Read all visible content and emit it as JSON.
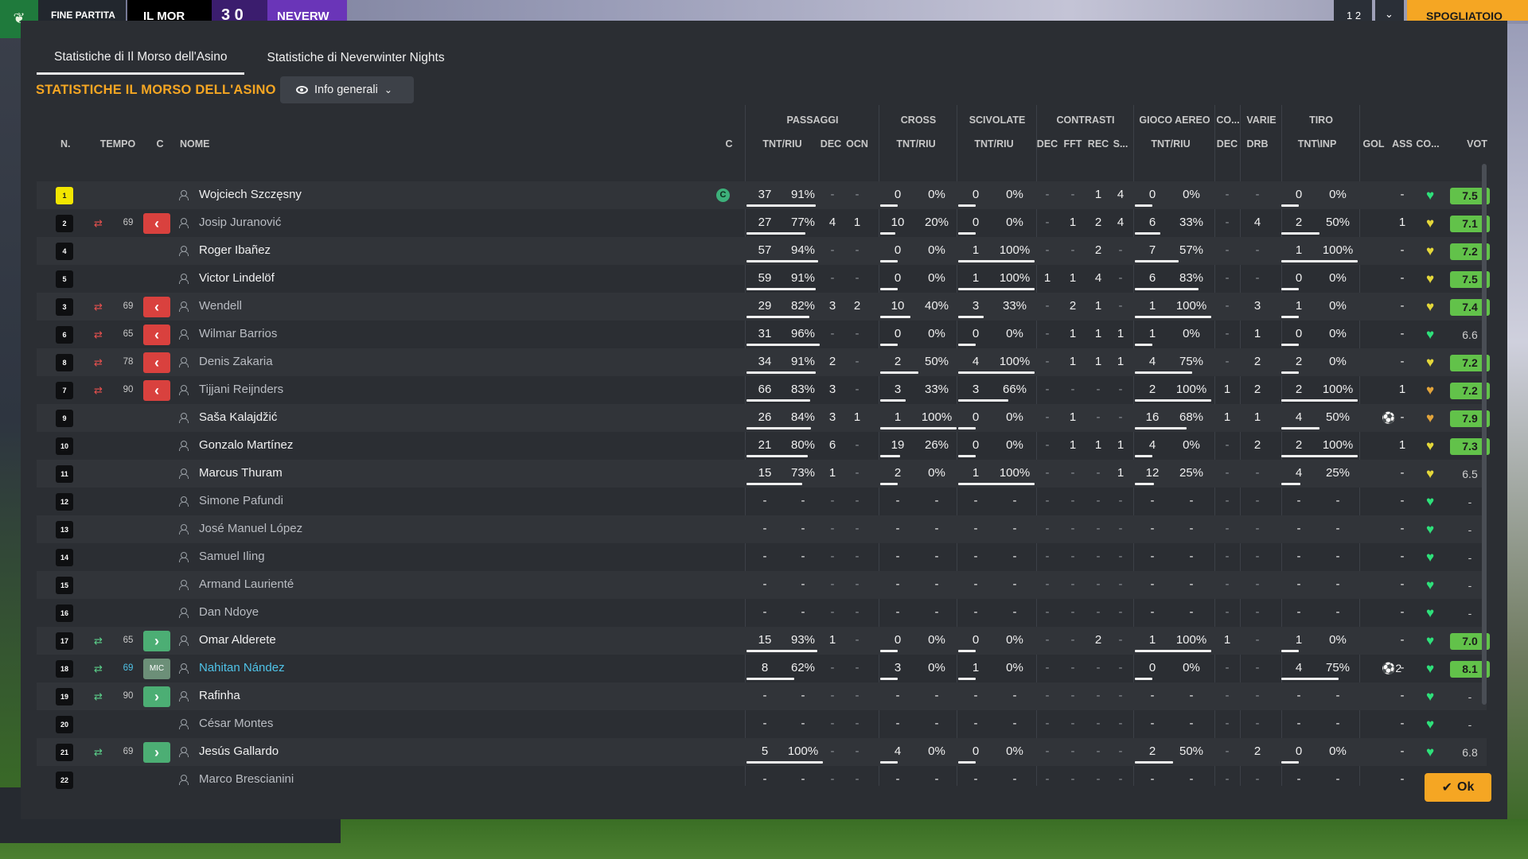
{
  "topbar": {
    "end_label": "FINE PARTITA",
    "home_team": "IL MOR",
    "score": "3 0",
    "away_team": "NEVERW",
    "right_label_1": "1 2",
    "right_label_2": "⌄",
    "right_label_3": "SPOGLIATOIO"
  },
  "tabs": [
    {
      "label": "Statistiche di Il Morso dell'Asino",
      "active": true
    },
    {
      "label": "Statistiche di Neverwinter Nights",
      "active": false
    }
  ],
  "section_title": "STATISTICHE IL MORSO DELL'ASINO",
  "view_dropdown": {
    "label": "Info generali"
  },
  "groups": [
    "PASSAGGI",
    "CROSS",
    "SCIVOLATE",
    "CONTRASTI",
    "GIOCO AEREO",
    "CO...",
    "VARIE",
    "TIRO"
  ],
  "headers": {
    "num": "N.",
    "tempo": "TEMPO",
    "c": "C",
    "nome": "NOME",
    "capt": "C",
    "pass_tr": "TNT/RIU",
    "pass_dec": "DEC",
    "pass_ocn": "OCN",
    "cross_tr": "TNT/RIU",
    "tack_tr": "TNT/RIU",
    "con_dec": "DEC",
    "con_fft": "FFT",
    "con_rec": "REC",
    "con_s": "S...",
    "air_tr": "TNT/RIU",
    "co_dec": "DEC",
    "var_drb": "DRB",
    "shot_tr": "TNT\\INP",
    "gol": "GOL",
    "ass": "ASS",
    "co": "CO...",
    "vot": "VOT"
  },
  "players": [
    {
      "num": "1",
      "gk": true,
      "name": "Wojciech Szczęsny",
      "captain": "C",
      "sub": null,
      "min": "",
      "pt": "37",
      "pr": "91%",
      "pdec": "-",
      "pocn": "-",
      "ct": "0",
      "cr": "0%",
      "tt": "0",
      "tr": "0%",
      "cdec": "-",
      "cfft": "-",
      "crec": "1",
      "cs": "4",
      "at": "0",
      "ar": "0%",
      "codec": "-",
      "drb": "-",
      "st": "0",
      "sr": "0%",
      "gol": "",
      "ass": "-",
      "heart": "green",
      "vot": "7.5",
      "vot_style": "good",
      "pass_pct": 91,
      "cross_pct": 0,
      "tack_pct": 0,
      "air_pct": 0,
      "shot_pct": 0,
      "style": ""
    },
    {
      "num": "2",
      "gk": false,
      "name": "Josip Juranović",
      "captain": "",
      "sub": "out",
      "min": "69",
      "pt": "27",
      "pr": "77%",
      "pdec": "4",
      "pocn": "1",
      "ct": "10",
      "cr": "20%",
      "tt": "0",
      "tr": "0%",
      "cdec": "-",
      "cfft": "1",
      "crec": "2",
      "cs": "4",
      "at": "6",
      "ar": "33%",
      "codec": "-",
      "drb": "4",
      "st": "2",
      "sr": "50%",
      "gol": "",
      "ass": "1",
      "heart": "yellow",
      "vot": "7.1",
      "vot_style": "good",
      "pass_pct": 77,
      "cross_pct": 20,
      "tack_pct": 0,
      "air_pct": 33,
      "shot_pct": 50,
      "style": "inactive"
    },
    {
      "num": "4",
      "gk": false,
      "name": "Roger Ibañez",
      "captain": "",
      "sub": null,
      "min": "",
      "pt": "57",
      "pr": "94%",
      "pdec": "-",
      "pocn": "-",
      "ct": "0",
      "cr": "0%",
      "tt": "1",
      "tr": "100%",
      "cdec": "-",
      "cfft": "-",
      "crec": "2",
      "cs": "-",
      "at": "7",
      "ar": "57%",
      "codec": "-",
      "drb": "-",
      "st": "1",
      "sr": "100%",
      "gol": "",
      "ass": "-",
      "heart": "yellow",
      "vot": "7.2",
      "vot_style": "good",
      "pass_pct": 94,
      "cross_pct": 0,
      "tack_pct": 100,
      "air_pct": 57,
      "shot_pct": 100,
      "style": ""
    },
    {
      "num": "5",
      "gk": false,
      "name": "Victor Lindelöf",
      "captain": "",
      "sub": null,
      "min": "",
      "pt": "59",
      "pr": "91%",
      "pdec": "-",
      "pocn": "-",
      "ct": "0",
      "cr": "0%",
      "tt": "1",
      "tr": "100%",
      "cdec": "1",
      "cfft": "1",
      "crec": "4",
      "cs": "-",
      "at": "6",
      "ar": "83%",
      "codec": "-",
      "drb": "-",
      "st": "0",
      "sr": "0%",
      "gol": "",
      "ass": "-",
      "heart": "yellow",
      "vot": "7.5",
      "vot_style": "good",
      "pass_pct": 91,
      "cross_pct": 0,
      "tack_pct": 100,
      "air_pct": 83,
      "shot_pct": 0,
      "style": ""
    },
    {
      "num": "3",
      "gk": false,
      "name": "Wendell",
      "captain": "",
      "sub": "out",
      "min": "69",
      "pt": "29",
      "pr": "82%",
      "pdec": "3",
      "pocn": "2",
      "ct": "10",
      "cr": "40%",
      "tt": "3",
      "tr": "33%",
      "cdec": "-",
      "cfft": "2",
      "crec": "1",
      "cs": "-",
      "at": "1",
      "ar": "100%",
      "codec": "-",
      "drb": "3",
      "st": "1",
      "sr": "0%",
      "gol": "",
      "ass": "-",
      "heart": "yellow",
      "vot": "7.4",
      "vot_style": "good",
      "pass_pct": 82,
      "cross_pct": 40,
      "tack_pct": 33,
      "air_pct": 100,
      "shot_pct": 0,
      "style": "inactive"
    },
    {
      "num": "6",
      "gk": false,
      "name": "Wilmar Barrios",
      "captain": "",
      "sub": "out",
      "min": "65",
      "pt": "31",
      "pr": "96%",
      "pdec": "-",
      "pocn": "-",
      "ct": "0",
      "cr": "0%",
      "tt": "0",
      "tr": "0%",
      "cdec": "-",
      "cfft": "1",
      "crec": "1",
      "cs": "1",
      "at": "1",
      "ar": "0%",
      "codec": "-",
      "drb": "1",
      "st": "0",
      "sr": "0%",
      "gol": "",
      "ass": "-",
      "heart": "green",
      "vot": "6.6",
      "vot_style": "plain",
      "pass_pct": 96,
      "cross_pct": 0,
      "tack_pct": 0,
      "air_pct": 0,
      "shot_pct": 0,
      "style": "inactive"
    },
    {
      "num": "8",
      "gk": false,
      "name": "Denis Zakaria",
      "captain": "",
      "sub": "out",
      "min": "78",
      "pt": "34",
      "pr": "91%",
      "pdec": "2",
      "pocn": "-",
      "ct": "2",
      "cr": "50%",
      "tt": "4",
      "tr": "100%",
      "cdec": "-",
      "cfft": "1",
      "crec": "1",
      "cs": "1",
      "at": "4",
      "ar": "75%",
      "codec": "-",
      "drb": "2",
      "st": "2",
      "sr": "0%",
      "gol": "",
      "ass": "-",
      "heart": "yellow",
      "vot": "7.2",
      "vot_style": "good",
      "pass_pct": 91,
      "cross_pct": 50,
      "tack_pct": 100,
      "air_pct": 75,
      "shot_pct": 0,
      "style": "inactive"
    },
    {
      "num": "7",
      "gk": false,
      "name": "Tijjani Reijnders",
      "captain": "",
      "sub": "out",
      "min": "90",
      "pt": "66",
      "pr": "83%",
      "pdec": "3",
      "pocn": "-",
      "ct": "3",
      "cr": "33%",
      "tt": "3",
      "tr": "66%",
      "cdec": "-",
      "cfft": "-",
      "crec": "-",
      "cs": "-",
      "at": "2",
      "ar": "100%",
      "codec": "1",
      "drb": "2",
      "st": "2",
      "sr": "100%",
      "gol": "",
      "ass": "1",
      "heart": "orange",
      "vot": "7.2",
      "vot_style": "good",
      "pass_pct": 83,
      "cross_pct": 33,
      "tack_pct": 66,
      "air_pct": 100,
      "shot_pct": 100,
      "style": "inactive"
    },
    {
      "num": "9",
      "gk": false,
      "name": "Saša Kalajdžić",
      "captain": "",
      "sub": null,
      "min": "",
      "pt": "26",
      "pr": "84%",
      "pdec": "3",
      "pocn": "1",
      "ct": "1",
      "cr": "100%",
      "tt": "0",
      "tr": "0%",
      "cdec": "-",
      "cfft": "1",
      "crec": "-",
      "cs": "-",
      "at": "16",
      "ar": "68%",
      "codec": "1",
      "drb": "1",
      "st": "4",
      "sr": "50%",
      "gol": "⚽",
      "ass": "-",
      "heart": "orange",
      "vot": "7.9",
      "vot_style": "good",
      "pass_pct": 84,
      "cross_pct": 100,
      "tack_pct": 0,
      "air_pct": 68,
      "shot_pct": 50,
      "style": ""
    },
    {
      "num": "10",
      "gk": false,
      "name": "Gonzalo Martínez",
      "captain": "",
      "sub": null,
      "min": "",
      "pt": "21",
      "pr": "80%",
      "pdec": "6",
      "pocn": "-",
      "ct": "19",
      "cr": "26%",
      "tt": "0",
      "tr": "0%",
      "cdec": "-",
      "cfft": "1",
      "crec": "1",
      "cs": "1",
      "at": "4",
      "ar": "0%",
      "codec": "-",
      "drb": "2",
      "st": "2",
      "sr": "100%",
      "gol": "",
      "ass": "1",
      "heart": "yellow",
      "vot": "7.3",
      "vot_style": "good",
      "pass_pct": 80,
      "cross_pct": 26,
      "tack_pct": 0,
      "air_pct": 0,
      "shot_pct": 100,
      "style": ""
    },
    {
      "num": "11",
      "gk": false,
      "name": "Marcus Thuram",
      "captain": "",
      "sub": null,
      "min": "",
      "pt": "15",
      "pr": "73%",
      "pdec": "1",
      "pocn": "-",
      "ct": "2",
      "cr": "0%",
      "tt": "1",
      "tr": "100%",
      "cdec": "-",
      "cfft": "-",
      "crec": "-",
      "cs": "1",
      "at": "12",
      "ar": "25%",
      "codec": "-",
      "drb": "-",
      "st": "4",
      "sr": "25%",
      "gol": "",
      "ass": "-",
      "heart": "yellow",
      "vot": "6.5",
      "vot_style": "plain",
      "pass_pct": 73,
      "cross_pct": 0,
      "tack_pct": 100,
      "air_pct": 25,
      "shot_pct": 25,
      "style": ""
    },
    {
      "num": "12",
      "gk": false,
      "name": "Simone Pafundi",
      "captain": "",
      "sub": null,
      "min": "",
      "pt": "-",
      "pr": "-",
      "pdec": "-",
      "pocn": "-",
      "ct": "-",
      "cr": "-",
      "tt": "-",
      "tr": "-",
      "cdec": "-",
      "cfft": "-",
      "crec": "-",
      "cs": "-",
      "at": "-",
      "ar": "-",
      "codec": "-",
      "drb": "-",
      "st": "-",
      "sr": "-",
      "gol": "",
      "ass": "-",
      "heart": "green",
      "vot": "-",
      "vot_style": "plain",
      "pass_pct": 0,
      "cross_pct": 0,
      "tack_pct": 0,
      "air_pct": 0,
      "shot_pct": 0,
      "style": "inactive"
    },
    {
      "num": "13",
      "gk": false,
      "name": "José Manuel López",
      "captain": "",
      "sub": null,
      "min": "",
      "pt": "-",
      "pr": "-",
      "pdec": "-",
      "pocn": "-",
      "ct": "-",
      "cr": "-",
      "tt": "-",
      "tr": "-",
      "cdec": "-",
      "cfft": "-",
      "crec": "-",
      "cs": "-",
      "at": "-",
      "ar": "-",
      "codec": "-",
      "drb": "-",
      "st": "-",
      "sr": "-",
      "gol": "",
      "ass": "-",
      "heart": "green",
      "vot": "-",
      "vot_style": "plain",
      "pass_pct": 0,
      "cross_pct": 0,
      "tack_pct": 0,
      "air_pct": 0,
      "shot_pct": 0,
      "style": "inactive"
    },
    {
      "num": "14",
      "gk": false,
      "name": "Samuel Iling",
      "captain": "",
      "sub": null,
      "min": "",
      "pt": "-",
      "pr": "-",
      "pdec": "-",
      "pocn": "-",
      "ct": "-",
      "cr": "-",
      "tt": "-",
      "tr": "-",
      "cdec": "-",
      "cfft": "-",
      "crec": "-",
      "cs": "-",
      "at": "-",
      "ar": "-",
      "codec": "-",
      "drb": "-",
      "st": "-",
      "sr": "-",
      "gol": "",
      "ass": "-",
      "heart": "green",
      "vot": "-",
      "vot_style": "plain",
      "pass_pct": 0,
      "cross_pct": 0,
      "tack_pct": 0,
      "air_pct": 0,
      "shot_pct": 0,
      "style": "inactive"
    },
    {
      "num": "15",
      "gk": false,
      "name": "Armand Laurienté",
      "captain": "",
      "sub": null,
      "min": "",
      "pt": "-",
      "pr": "-",
      "pdec": "-",
      "pocn": "-",
      "ct": "-",
      "cr": "-",
      "tt": "-",
      "tr": "-",
      "cdec": "-",
      "cfft": "-",
      "crec": "-",
      "cs": "-",
      "at": "-",
      "ar": "-",
      "codec": "-",
      "drb": "-",
      "st": "-",
      "sr": "-",
      "gol": "",
      "ass": "-",
      "heart": "green",
      "vot": "-",
      "vot_style": "plain",
      "pass_pct": 0,
      "cross_pct": 0,
      "tack_pct": 0,
      "air_pct": 0,
      "shot_pct": 0,
      "style": "inactive"
    },
    {
      "num": "16",
      "gk": false,
      "name": "Dan Ndoye",
      "captain": "",
      "sub": null,
      "min": "",
      "pt": "-",
      "pr": "-",
      "pdec": "-",
      "pocn": "-",
      "ct": "-",
      "cr": "-",
      "tt": "-",
      "tr": "-",
      "cdec": "-",
      "cfft": "-",
      "crec": "-",
      "cs": "-",
      "at": "-",
      "ar": "-",
      "codec": "-",
      "drb": "-",
      "st": "-",
      "sr": "-",
      "gol": "",
      "ass": "-",
      "heart": "green",
      "vot": "-",
      "vot_style": "plain",
      "pass_pct": 0,
      "cross_pct": 0,
      "tack_pct": 0,
      "air_pct": 0,
      "shot_pct": 0,
      "style": "inactive"
    },
    {
      "num": "17",
      "gk": false,
      "name": "Omar Alderete",
      "captain": "",
      "sub": "in",
      "min": "65",
      "pt": "15",
      "pr": "93%",
      "pdec": "1",
      "pocn": "-",
      "ct": "0",
      "cr": "0%",
      "tt": "0",
      "tr": "0%",
      "cdec": "-",
      "cfft": "-",
      "crec": "2",
      "cs": "-",
      "at": "1",
      "ar": "100%",
      "codec": "1",
      "drb": "-",
      "st": "1",
      "sr": "0%",
      "gol": "",
      "ass": "-",
      "heart": "green",
      "vot": "7.0",
      "vot_style": "good",
      "pass_pct": 93,
      "cross_pct": 0,
      "tack_pct": 0,
      "air_pct": 100,
      "shot_pct": 0,
      "style": ""
    },
    {
      "num": "18",
      "gk": false,
      "name": "Nahitan Nández",
      "captain": "",
      "sub": "mic",
      "min": "69",
      "pt": "8",
      "pr": "62%",
      "pdec": "-",
      "pocn": "-",
      "ct": "3",
      "cr": "0%",
      "tt": "1",
      "tr": "0%",
      "cdec": "-",
      "cfft": "-",
      "crec": "-",
      "cs": "-",
      "at": "0",
      "ar": "0%",
      "codec": "-",
      "drb": "-",
      "st": "4",
      "sr": "75%",
      "gol": "⚽2",
      "ass": "-",
      "heart": "green",
      "vot": "8.1",
      "vot_style": "good",
      "pass_pct": 62,
      "cross_pct": 0,
      "tack_pct": 0,
      "air_pct": 0,
      "shot_pct": 75,
      "style": "link"
    },
    {
      "num": "19",
      "gk": false,
      "name": "Rafinha",
      "captain": "",
      "sub": "in",
      "min": "90",
      "pt": "-",
      "pr": "-",
      "pdec": "-",
      "pocn": "-",
      "ct": "-",
      "cr": "-",
      "tt": "-",
      "tr": "-",
      "cdec": "-",
      "cfft": "-",
      "crec": "-",
      "cs": "-",
      "at": "-",
      "ar": "-",
      "codec": "-",
      "drb": "-",
      "st": "-",
      "sr": "-",
      "gol": "",
      "ass": "-",
      "heart": "green",
      "vot": "-",
      "vot_style": "plain",
      "pass_pct": 0,
      "cross_pct": 0,
      "tack_pct": 0,
      "air_pct": 0,
      "shot_pct": 0,
      "style": ""
    },
    {
      "num": "20",
      "gk": false,
      "name": "César Montes",
      "captain": "",
      "sub": null,
      "min": "",
      "pt": "-",
      "pr": "-",
      "pdec": "-",
      "pocn": "-",
      "ct": "-",
      "cr": "-",
      "tt": "-",
      "tr": "-",
      "cdec": "-",
      "cfft": "-",
      "crec": "-",
      "cs": "-",
      "at": "-",
      "ar": "-",
      "codec": "-",
      "drb": "-",
      "st": "-",
      "sr": "-",
      "gol": "",
      "ass": "-",
      "heart": "green",
      "vot": "-",
      "vot_style": "plain",
      "pass_pct": 0,
      "cross_pct": 0,
      "tack_pct": 0,
      "air_pct": 0,
      "shot_pct": 0,
      "style": "inactive"
    },
    {
      "num": "21",
      "gk": false,
      "name": "Jesús Gallardo",
      "captain": "",
      "sub": "in",
      "min": "69",
      "pt": "5",
      "pr": "100%",
      "pdec": "-",
      "pocn": "-",
      "ct": "4",
      "cr": "0%",
      "tt": "0",
      "tr": "0%",
      "cdec": "-",
      "cfft": "-",
      "crec": "-",
      "cs": "-",
      "at": "2",
      "ar": "50%",
      "codec": "-",
      "drb": "2",
      "st": "0",
      "sr": "0%",
      "gol": "",
      "ass": "-",
      "heart": "green",
      "vot": "6.8",
      "vot_style": "plain",
      "pass_pct": 100,
      "cross_pct": 0,
      "tack_pct": 0,
      "air_pct": 50,
      "shot_pct": 0,
      "style": ""
    },
    {
      "num": "22",
      "gk": false,
      "name": "Marco Brescianini",
      "captain": "",
      "sub": null,
      "min": "",
      "pt": "-",
      "pr": "-",
      "pdec": "-",
      "pocn": "-",
      "ct": "-",
      "cr": "-",
      "tt": "-",
      "tr": "-",
      "cdec": "-",
      "cfft": "-",
      "crec": "-",
      "cs": "-",
      "at": "-",
      "ar": "-",
      "codec": "-",
      "drb": "-",
      "st": "-",
      "sr": "-",
      "gol": "",
      "ass": "-",
      "heart": "green",
      "vot": "-",
      "vot_style": "plain",
      "pass_pct": 0,
      "cross_pct": 0,
      "tack_pct": 0,
      "air_pct": 0,
      "shot_pct": 0,
      "style": "inactive"
    }
  ],
  "ok_button": {
    "label": "Ok"
  },
  "colors": {
    "accent": "#f5a623",
    "panel": "#2b2e33",
    "heart_green": "#2ee07a",
    "rating_good": "#62c24a"
  },
  "icons": {
    "person": "person-icon",
    "captain": "captain-badge-icon",
    "heart": "heart-icon",
    "ball": "football-icon",
    "sub_out": "arrows-out-icon",
    "sub_in": "arrows-in-icon"
  }
}
